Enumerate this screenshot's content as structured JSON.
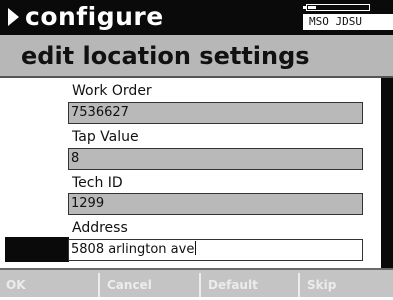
{
  "topbar": {
    "title": "configure",
    "battery_letter": "E",
    "battery_letter_right": "F",
    "brand": "MSO JDSU"
  },
  "header": {
    "title": "edit location settings"
  },
  "form": {
    "fields": [
      {
        "label": "Work Order",
        "value": "7536627"
      },
      {
        "label": "Tap Value",
        "value": "8"
      },
      {
        "label": "Tech ID",
        "value": "1299"
      },
      {
        "label": "Address",
        "value": "5808 arlington ave"
      }
    ]
  },
  "softkeys": [
    "OK",
    "Cancel",
    "Default",
    "Skip"
  ]
}
